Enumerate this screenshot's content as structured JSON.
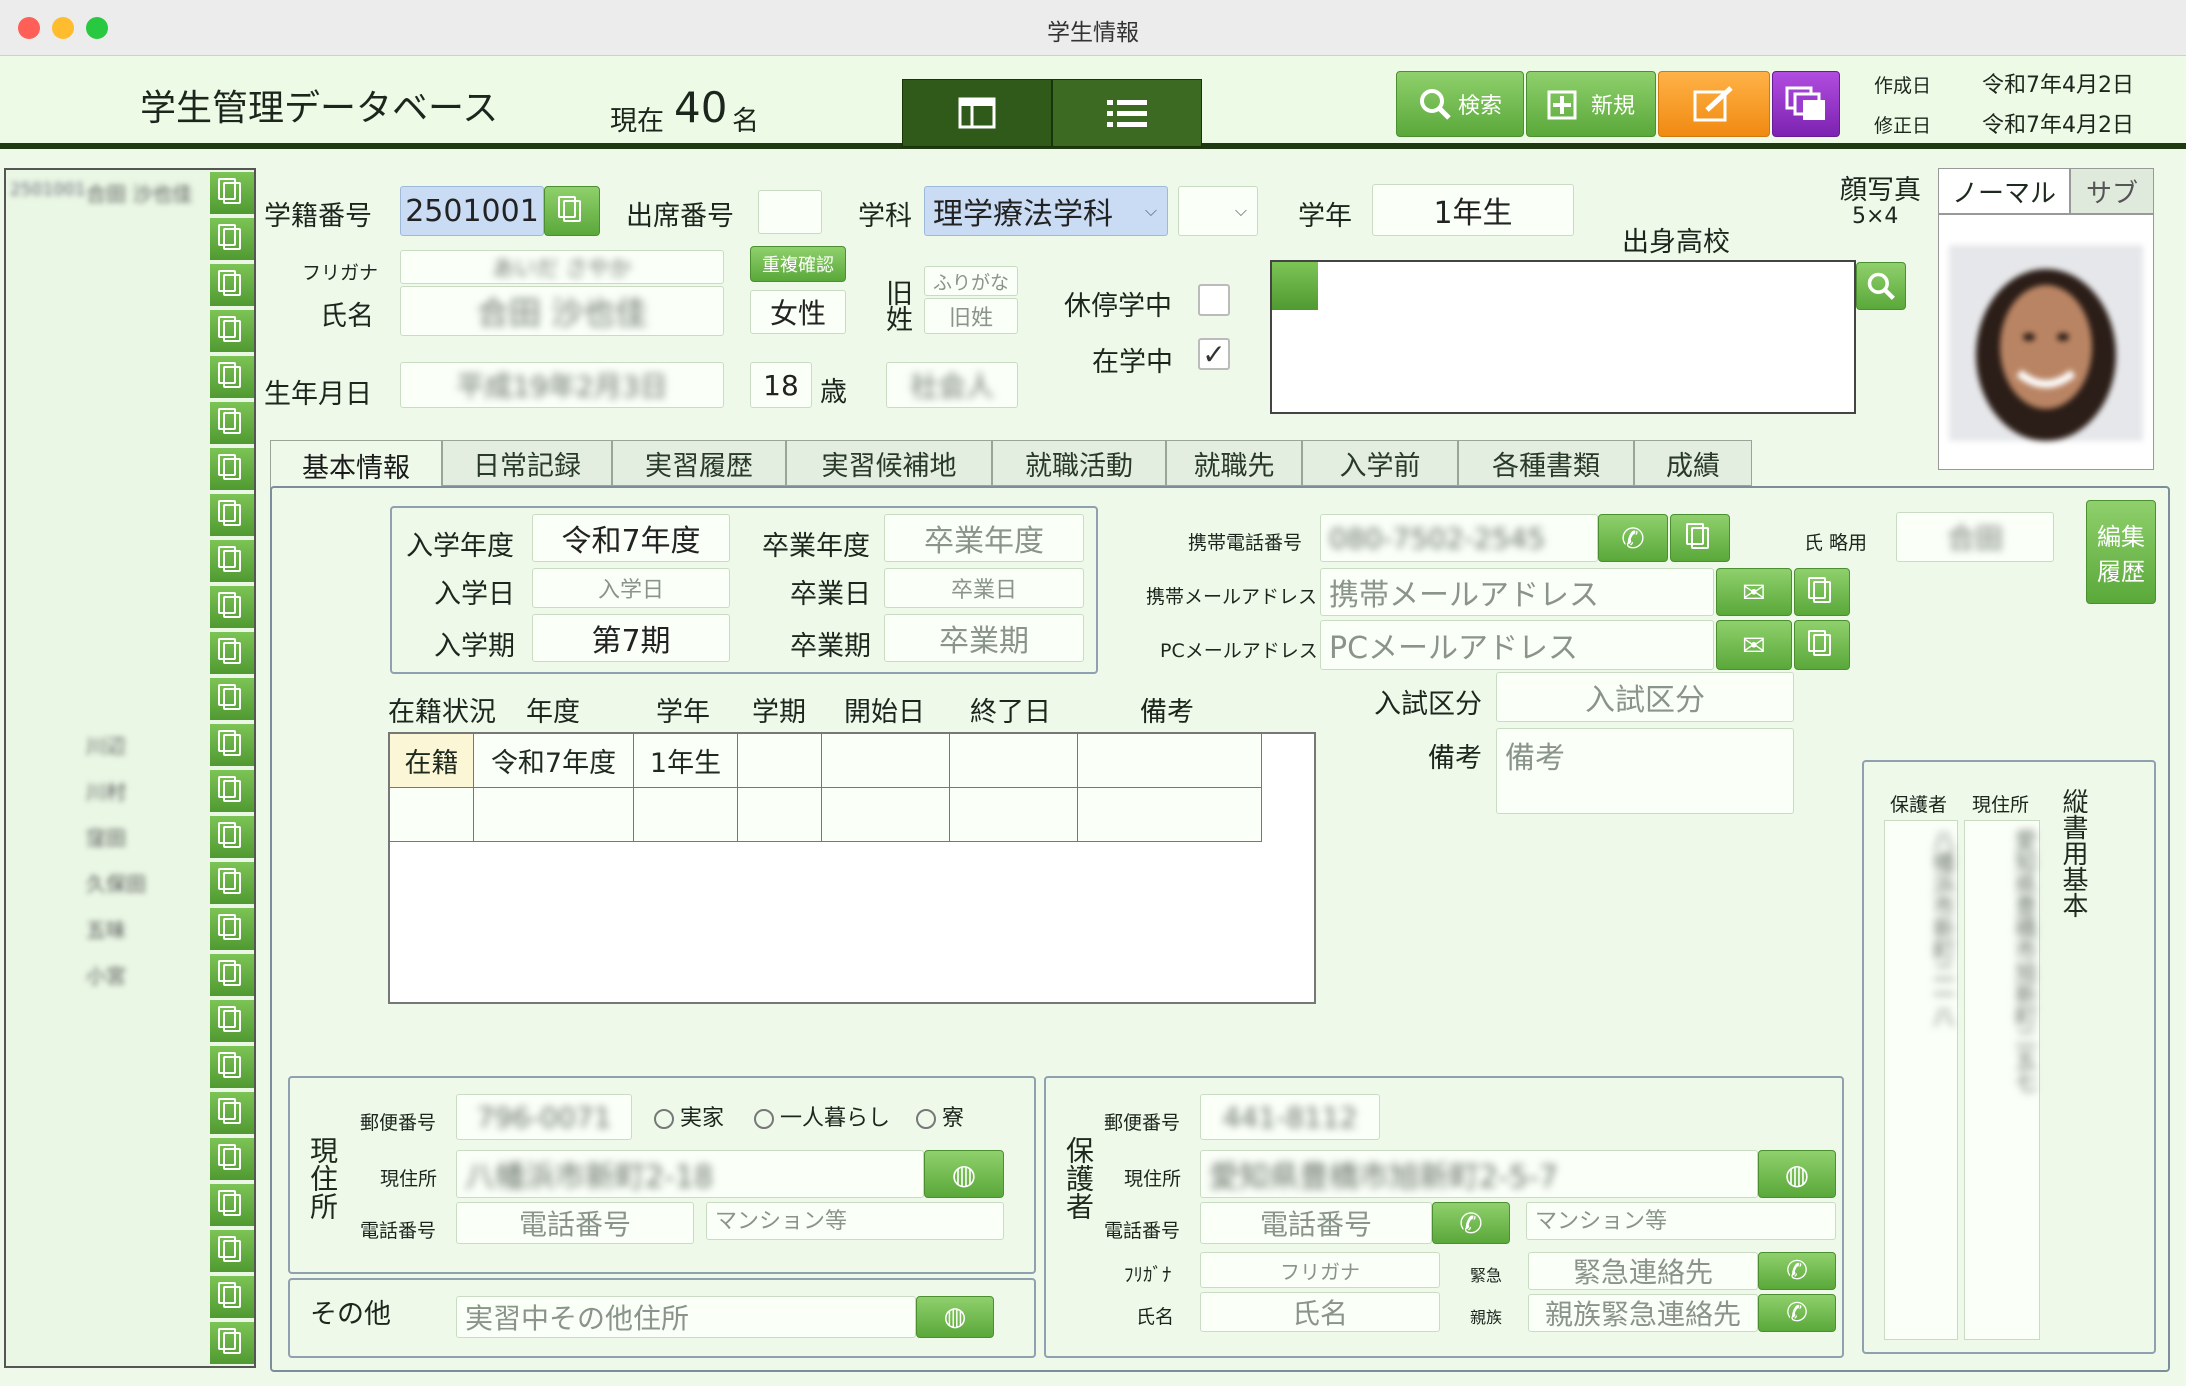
{
  "window": {
    "title": "学生情報"
  },
  "header": {
    "app_title": "学生管理データベース",
    "count_prefix": "現在",
    "count_value": "40",
    "count_suffix": "名",
    "search_label": "検索",
    "new_label": "新規",
    "created_label": "作成日",
    "created_value": "令和7年4月2日",
    "modified_label": "修正日",
    "modified_value": "令和7年4月2日"
  },
  "sidebar": {
    "first_id": "2501001",
    "first_name": "合田 沙也佳",
    "names": [
      "",
      "",
      "",
      "",
      "",
      "",
      "",
      "",
      "",
      "",
      "",
      "",
      "川辺",
      "川村",
      "窪田",
      "久保田",
      "五味",
      "小宮",
      "",
      "",
      "",
      "",
      "",
      "",
      "",
      ""
    ]
  },
  "student": {
    "id_label": "学籍番号",
    "id_value": "2501001",
    "attendance_label": "出席番号",
    "attendance_value": "",
    "dept_label": "学科",
    "dept_value": "理学療法学科",
    "grade_label": "学年",
    "grade_value": "1年生",
    "furigana_label": "フリガナ",
    "furigana_value": "あいだ さやか",
    "name_label": "氏名",
    "name_value": "合田 沙也佳",
    "dup_check": "重複確認",
    "gender": "女性",
    "old_name_label_1": "旧",
    "old_name_label_2": "姓",
    "old_furigana_ph": "ふりがな",
    "old_name_ph": "旧姓",
    "leave_label": "休停学中",
    "enrolled_label": "在学中",
    "enrolled_checked": "✓",
    "hs_label": "出身高校",
    "birth_label": "生年月日",
    "birth_value": "平成19年2月3日",
    "age_value": "18",
    "age_suffix": "歳",
    "social": "社会人",
    "photo_label_1": "顔写真",
    "photo_label_2": "5×4",
    "photo_tab_normal": "ノーマル",
    "photo_tab_sub": "サブ"
  },
  "tabs": [
    "基本情報",
    "日常記録",
    "実習履歴",
    "実習候補地",
    "就職活動",
    "就職先",
    "入学前",
    "各種書類",
    "成績"
  ],
  "enroll": {
    "entry_year_label": "入学年度",
    "entry_year_value": "令和7年度",
    "grad_year_label": "卒業年度",
    "grad_year_ph": "卒業年度",
    "entry_date_label": "入学日",
    "entry_date_ph": "入学日",
    "grad_date_label": "卒業日",
    "grad_date_ph": "卒業日",
    "entry_term_label": "入学期",
    "entry_term_value": "第7期",
    "grad_term_label": "卒業期",
    "grad_term_ph": "卒業期"
  },
  "status_table": {
    "headers": [
      "在籍状況",
      "年度",
      "学年",
      "学期",
      "開始日",
      "終了日",
      "備考"
    ],
    "row1": [
      "在籍",
      "令和7年度",
      "1年生",
      "",
      "",
      "",
      ""
    ]
  },
  "contact": {
    "mobile_label": "携帯電話番号",
    "mobile_value": "080-7502-2545",
    "mobile_mail_label": "携帯メールアドレス",
    "mobile_mail_ph": "携帯メールアドレス",
    "pc_mail_label": "PCメールアドレス",
    "pc_mail_ph": "PCメールアドレス",
    "short_name_label": "氏 略用",
    "short_name_value": "合田",
    "edit_history_1": "編集",
    "edit_history_2": "履歴",
    "exam_label": "入試区分",
    "exam_ph": "入試区分",
    "notes_label": "備考",
    "notes_ph": "備考"
  },
  "vertical": {
    "guardian_label": "保護者",
    "current_label": "現住所",
    "title": "縦書用基本",
    "guardian_addr": "八幡浜市新町二一八",
    "current_addr": "愛知県豊橋市旭新町二五七"
  },
  "address": {
    "section_label": "現住所",
    "zip_label": "郵便番号",
    "zip_value": "796-0071",
    "opt1": "実家",
    "opt2": "一人暮らし",
    "opt3": "寮",
    "addr_label": "現住所",
    "addr_value": "八幡浜市新町2-18",
    "tel_label": "電話番号",
    "tel_ph": "電話番号",
    "mansion_ph": "マンション等",
    "other_label": "その他",
    "other_ph": "実習中その他住所"
  },
  "guardian": {
    "section_label": "保護者",
    "zip_label": "郵便番号",
    "zip_value": "441-8112",
    "addr_label": "現住所",
    "addr_value": "愛知県豊橋市旭新町2-5-7",
    "tel_label": "電話番号",
    "tel_ph": "電話番号",
    "mansion_ph": "マンション等",
    "furigana_label": "ﾌﾘｶﾞﾅ",
    "furigana_ph": "フリガナ",
    "name_label": "氏名",
    "name_ph": "氏名",
    "emergency_label": "緊急",
    "emergency_ph": "緊急連絡先",
    "relative_label": "親族",
    "relative_ph": "親族緊急連絡先"
  }
}
